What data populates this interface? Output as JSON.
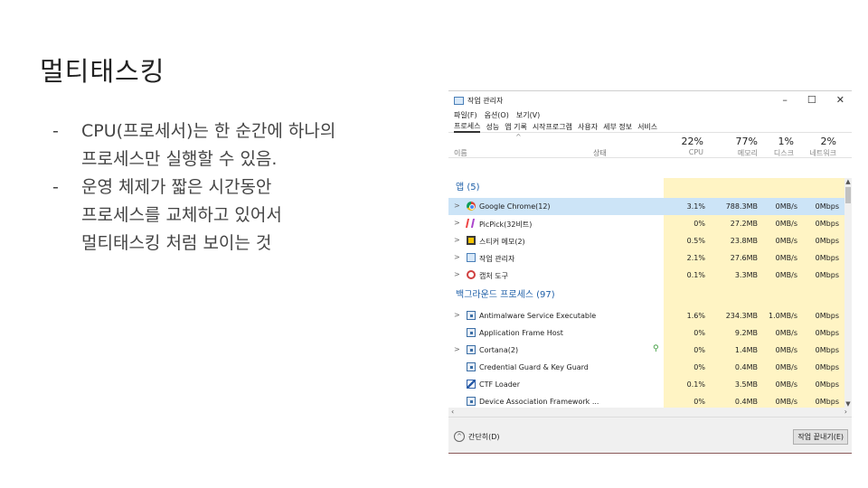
{
  "slide": {
    "title": "멀티태스킹",
    "bullets": [
      {
        "dash": "-",
        "lines": [
          "CPU(프로세서)는 한 순간에 하나의",
          "프로세스만 실행할 수 있음."
        ]
      },
      {
        "dash": "-",
        "lines": [
          "운영 체제가 짧은 시간동안",
          "프로세스를 교체하고 있어서",
          "멀티태스킹 처럼 보이는 것"
        ]
      }
    ]
  },
  "task_manager": {
    "window_title": "작업 관리자",
    "window_controls": {
      "minimize": "–",
      "maximize": "☐",
      "close": "✕"
    },
    "menu": [
      "파일(F)",
      "옵션(O)",
      "보기(V)"
    ],
    "tabs": [
      "프로세스",
      "성능",
      "앱 기록",
      "시작프로그램",
      "사용자",
      "세부 정보",
      "서비스"
    ],
    "active_tab": "프로세스",
    "columns": {
      "name": "이름",
      "status": "상태",
      "cpu": {
        "pct": "22%",
        "label": "CPU"
      },
      "memory": {
        "pct": "77%",
        "label": "메모리"
      },
      "disk": {
        "pct": "1%",
        "label": "디스크"
      },
      "network": {
        "pct": "2%",
        "label": "네트워크"
      }
    },
    "sort_indicator": "^",
    "sections": {
      "apps": "앱 (5)",
      "background": "백그라운드 프로세스 (97)"
    },
    "apps": [
      {
        "name": "Google Chrome(12)",
        "icon": "chrome-icon",
        "expand": ">",
        "cpu": "3.1%",
        "mem": "788.3MB",
        "disk": "0MB/s",
        "net": "0Mbps",
        "selected": true
      },
      {
        "name": "PicPick(32비트)",
        "icon": "picpick-icon",
        "expand": ">",
        "cpu": "0%",
        "mem": "27.2MB",
        "disk": "0MB/s",
        "net": "0Mbps"
      },
      {
        "name": "스티커 메모(2)",
        "icon": "sticky-notes-icon",
        "expand": ">",
        "cpu": "0.5%",
        "mem": "23.8MB",
        "disk": "0MB/s",
        "net": "0Mbps"
      },
      {
        "name": "작업 관리자",
        "icon": "task-manager-icon",
        "expand": ">",
        "cpu": "2.1%",
        "mem": "27.6MB",
        "disk": "0MB/s",
        "net": "0Mbps"
      },
      {
        "name": "캡처 도구",
        "icon": "snipping-tool-icon",
        "expand": ">",
        "cpu": "0.1%",
        "mem": "3.3MB",
        "disk": "0MB/s",
        "net": "0Mbps"
      }
    ],
    "background": [
      {
        "name": "Antimalware Service Executable",
        "icon": "service-icon",
        "expand": ">",
        "cpu": "1.6%",
        "mem": "234.3MB",
        "disk": "1.0MB/s",
        "net": "0Mbps"
      },
      {
        "name": "Application Frame Host",
        "icon": "service-icon",
        "expand": "",
        "cpu": "0%",
        "mem": "9.2MB",
        "disk": "0MB/s",
        "net": "0Mbps"
      },
      {
        "name": "Cortana(2)",
        "icon": "service-icon",
        "expand": ">",
        "eco": "⚲",
        "cpu": "0%",
        "mem": "1.4MB",
        "disk": "0MB/s",
        "net": "0Mbps"
      },
      {
        "name": "Credential Guard & Key Guard",
        "icon": "service-icon",
        "expand": "",
        "cpu": "0%",
        "mem": "0.4MB",
        "disk": "0MB/s",
        "net": "0Mbps"
      },
      {
        "name": "CTF Loader",
        "icon": "ctf-loader-icon",
        "expand": "",
        "cpu": "0.1%",
        "mem": "3.5MB",
        "disk": "0MB/s",
        "net": "0Mbps"
      },
      {
        "name": "Device Association Framework ...",
        "icon": "service-icon",
        "expand": "",
        "cpu": "0%",
        "mem": "0.4MB",
        "disk": "0MB/s",
        "net": "0Mbps"
      }
    ],
    "footer": {
      "fewer_details": "간단히(D)",
      "end_task": "작업 끝내기(E)"
    },
    "colors": {
      "selected_row": "#cce4f7",
      "usage_bg": "#fff4c4",
      "section_text": "#1e5fa8"
    }
  }
}
